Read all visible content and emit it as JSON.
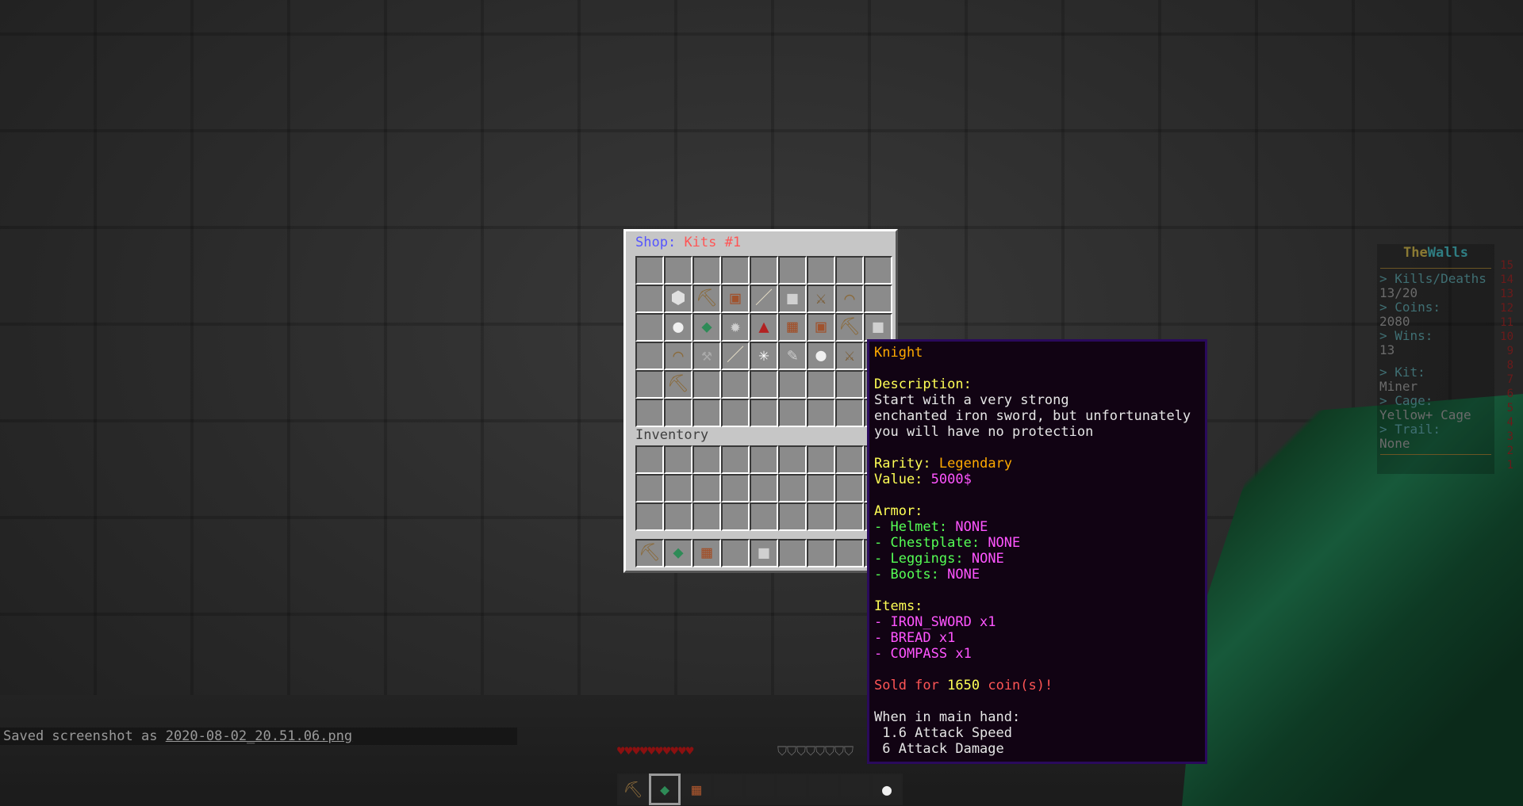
{
  "chest": {
    "title_prefix": "Shop:",
    "title_name": "Kits #1",
    "shop_slots": [
      "",
      "",
      "",
      "",
      "",
      "",
      "",
      "",
      "",
      "",
      "⬢",
      "⛏",
      "▣",
      "／",
      "■",
      "⚔",
      "⌒",
      "",
      "",
      "●",
      "◆",
      "✹",
      "▲",
      "▦",
      "▣",
      "⛏",
      "■",
      "",
      "⌒",
      "⚒",
      "／",
      "✳",
      "✎",
      "●",
      "⚔",
      "",
      "",
      "⛏",
      "",
      "",
      "",
      "",
      "",
      "",
      "",
      "",
      "",
      "",
      "",
      "",
      "",
      "",
      "",
      ""
    ],
    "inventory_title": "Inventory",
    "inventory_slots": [
      "",
      "",
      "",
      "",
      "",
      "",
      "",
      "",
      "",
      "",
      "",
      "",
      "",
      "",
      "",
      "",
      "",
      "",
      "",
      "",
      "",
      "",
      "",
      "",
      "",
      "",
      ""
    ],
    "hotbar_slots": [
      "⛏",
      "◆",
      "▦",
      "",
      "■",
      "",
      "",
      "",
      ""
    ]
  },
  "tooltip": {
    "name": "Knight",
    "description_label": "Description:",
    "description_lines": [
      "Start with a very strong",
      "enchanted iron sword, but unfortunately",
      "you will have no protection"
    ],
    "rarity_label": "Rarity:",
    "rarity_value": "Legendary",
    "value_label": "Value:",
    "value_value": "5000$",
    "armor_label": "Armor:",
    "armor": [
      {
        "slot": "- Helmet:",
        "value": "NONE"
      },
      {
        "slot": "- Chestplate:",
        "value": "NONE"
      },
      {
        "slot": "- Leggings:",
        "value": "NONE"
      },
      {
        "slot": "- Boots:",
        "value": "NONE"
      }
    ],
    "items_label": "Items:",
    "items": [
      "- IRON_SWORD x1",
      "- BREAD x1",
      "- COMPASS x1"
    ],
    "sold_prefix": "Sold for",
    "sold_amount": "1650",
    "sold_suffix": "coin(s)!",
    "main_hand_label": "When in main hand:",
    "attack_speed": " 1.6 Attack Speed",
    "attack_damage": " 6 Attack Damage"
  },
  "scoreboard": {
    "title_a": "The",
    "title_b": "Walls",
    "kd_label": "> Kills/Deaths",
    "kd_value": "13/20",
    "coins_label": "> Coins:",
    "coins_value": "2080",
    "wins_label": "> Wins:",
    "wins_value": "13",
    "kit_label": "> Kit:",
    "kit_value": "Miner",
    "cage_label": "> Cage:",
    "cage_value": "Yellow+ Cage",
    "trail_label": "> Trail:",
    "trail_value": "None",
    "line_numbers": [
      "15",
      "14",
      "13",
      "12",
      "11",
      "10",
      "9",
      "8",
      "7",
      "6",
      "5",
      "4",
      "3",
      "2",
      "1"
    ]
  },
  "chat": {
    "prefix": "Saved screenshot as ",
    "filename": "2020-08-02_20.51.06.png"
  },
  "hud": {
    "hearts": "♥♥♥♥♥♥♥♥♥♥",
    "armor": "⛉⛉⛉⛉⛉⛉⛉⛉",
    "hotbar": [
      "⛏",
      "◆",
      "▦",
      "",
      "",
      "",
      "",
      "",
      "●"
    ],
    "selected_slot": 1
  },
  "colors": {
    "shop_title": "#5555ff",
    "kits_title": "#ff5555",
    "tooltip_bg": "#110313",
    "tooltip_border": "#2a0a5c"
  }
}
